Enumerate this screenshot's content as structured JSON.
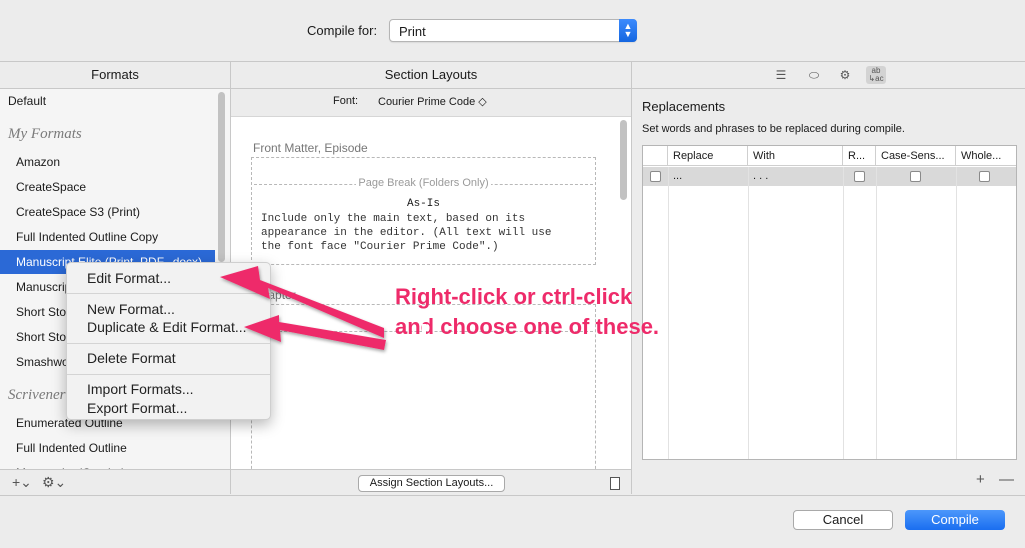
{
  "compile": {
    "label": "Compile for:",
    "value": "Print"
  },
  "columns": {
    "formats": "Formats",
    "section_layouts": "Section Layouts"
  },
  "formats": {
    "default": "Default",
    "my_formats_heading": "My Formats",
    "my_formats": [
      "Amazon",
      "CreateSpace",
      "CreateSpace S3 (Print)",
      "Full Indented Outline Copy",
      "Manuscript Elite (Print, PDF, .docx)",
      "Manuscript",
      "Short Sto",
      "Short Sto",
      "Smashwo"
    ],
    "scrivener_heading": "Scrivener",
    "scrivener_formats": [
      "Enumerated Outline",
      "Full Indented Outline",
      "Manuscript (Courier)"
    ],
    "footer": {
      "add": "+⌄",
      "gear": "⚙⌄"
    }
  },
  "section_layouts": {
    "font_label": "Font:",
    "font_value": "Courier Prime Code ◇",
    "layout1": {
      "title": "Front Matter, Episode",
      "page_break": "Page Break (Folders Only)",
      "name": "As-Is",
      "description_lines": [
        "Include only the main text, based on its",
        "appearance in the editor. (All text will use",
        "the font face \"Courier Prime Code\".)"
      ]
    },
    "layout2_title": "Chapter",
    "assign_button": "Assign Section Layouts..."
  },
  "replacements": {
    "title": "Replacements",
    "subtitle": "Set words and phrases to be replaced during compile.",
    "columns": [
      "Replace",
      "With",
      "R...",
      "Case-Sens...",
      "Whole..."
    ],
    "row": {
      "replace": "...",
      "with": ". . ."
    },
    "toolbar_icons": [
      "list-icon",
      "label-icon",
      "gear-icon",
      "replace-icon"
    ],
    "replace_icon_text": "ab\n↳ac",
    "add": "+",
    "remove": "—"
  },
  "buttons": {
    "cancel": "Cancel",
    "compile": "Compile"
  },
  "context_menu": {
    "items": [
      "Edit Format...",
      "New Format...",
      "Duplicate & Edit Format...",
      "Delete Format",
      "Import Formats...",
      "Export Format..."
    ]
  },
  "annotation": {
    "line1": "Right-click or ctrl-click",
    "line2": "and choose one of these."
  },
  "colors": {
    "accent": "#2b69d6",
    "annotation": "#ee2b6a"
  }
}
